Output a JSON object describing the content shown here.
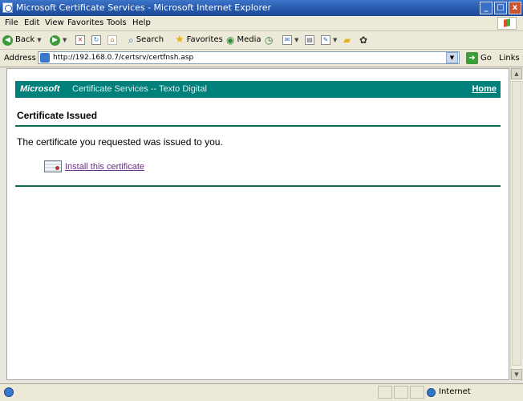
{
  "window": {
    "title": "Microsoft Certificate Services - Microsoft Internet Explorer",
    "minimize": "_",
    "maximize": "□",
    "close": "x"
  },
  "menu": [
    "File",
    "Edit",
    "View",
    "Favorites",
    "Tools",
    "Help"
  ],
  "toolbar": {
    "back_label": "Back",
    "search_label": "Search",
    "favorites_label": "Favorites",
    "media_label": "Media"
  },
  "addressbar": {
    "label": "Address",
    "url": "http://192.168.0.7/certsrv/certfnsh.asp",
    "go_label": "Go",
    "links_label": "Links"
  },
  "page": {
    "header_brand": "Microsoft",
    "header_service": "Certificate Services  --  Texto Digital",
    "home_link": "Home",
    "title": "Certificate Issued",
    "message": "The certificate you requested was issued to you.",
    "install_link": "Install this certificate"
  },
  "statusbar": {
    "zone": "Internet"
  },
  "colors": {
    "header_bg": "#00807a",
    "rule": "#0d6d56",
    "link": "#6a2d86",
    "titlebar": "#2456a8"
  }
}
